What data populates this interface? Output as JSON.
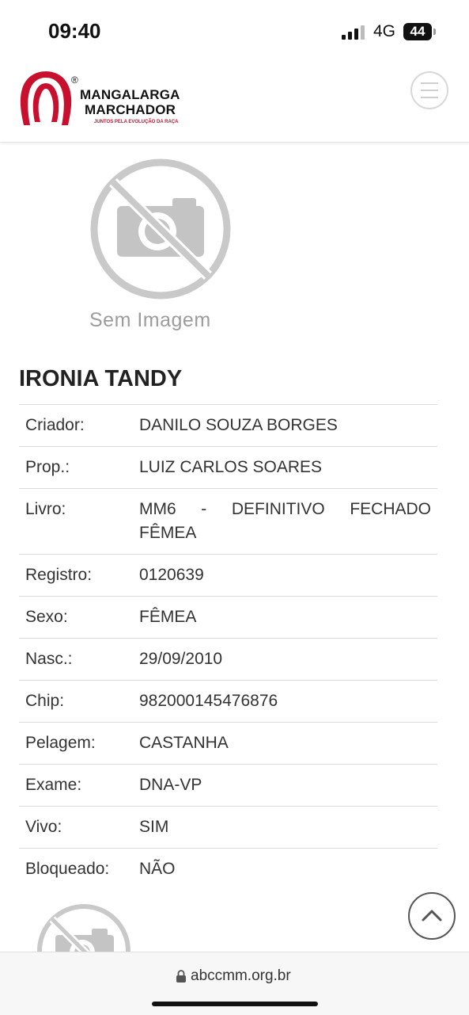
{
  "status_bar": {
    "time": "09:40",
    "network": "4G",
    "battery": "44"
  },
  "header": {
    "brand_line1": "MANGALARGA",
    "brand_line2": "MARCHADOR",
    "tagline": "JUNTOS PELA EVOLUÇÃO DA RAÇA",
    "registered_mark": "®",
    "menu_icon": "hamburger-icon"
  },
  "placeholder": {
    "label": "Sem Imagem"
  },
  "animal": {
    "name": "IRONIA TANDY",
    "details": [
      {
        "label": "Criador:",
        "value": "DANILO SOUZA BORGES"
      },
      {
        "label": "Prop.:",
        "value": "LUIZ CARLOS SOARES"
      },
      {
        "label": "Livro:",
        "value": "MM6 - DEFINITIVO FECHADO FÊMEA"
      },
      {
        "label": "Registro:",
        "value": "0120639"
      },
      {
        "label": "Sexo:",
        "value": "FÊMEA"
      },
      {
        "label": "Nasc.:",
        "value": "29/09/2010"
      },
      {
        "label": "Chip:",
        "value": "982000145476876"
      },
      {
        "label": "Pelagem:",
        "value": "CASTANHA"
      },
      {
        "label": "Exame:",
        "value": "DNA-VP"
      },
      {
        "label": "Vivo:",
        "value": "SIM"
      },
      {
        "label": "Bloqueado:",
        "value": "NÃO"
      }
    ]
  },
  "browser": {
    "url": "abccmm.org.br"
  },
  "colors": {
    "brand_red": "#c8102e",
    "text": "#222222",
    "divider": "#dcdcdc"
  }
}
